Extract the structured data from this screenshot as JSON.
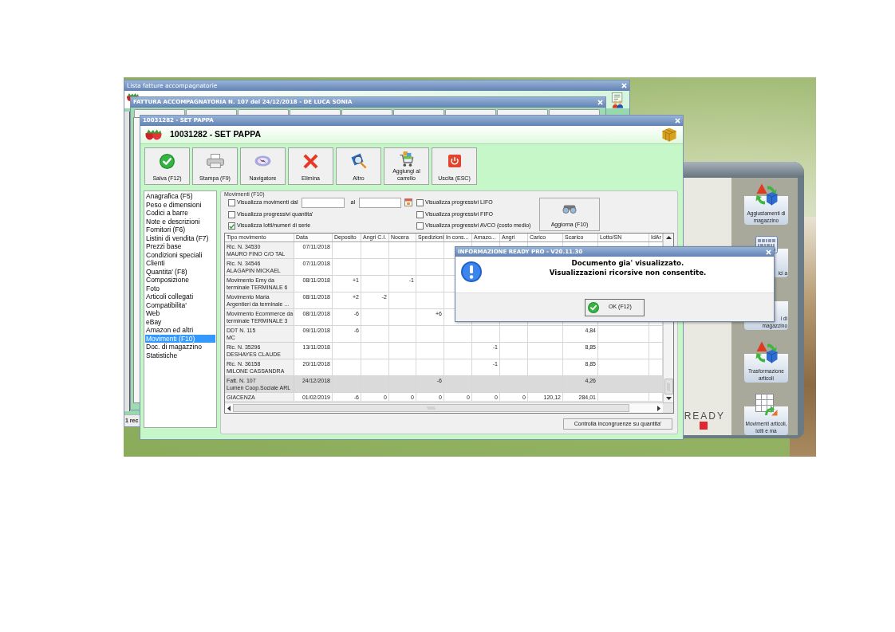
{
  "list_window": {
    "title": "Lista fatture accompagnatorie",
    "status": "1 rec"
  },
  "invoice_window": {
    "title": "FATTURA ACCOMPAGNATORIA N. 107 del 24/12/2018 - DE LUCA SONIA"
  },
  "side_panel": {
    "buttons": [
      {
        "lines": [
          "Aggiustamenti di",
          "magazzino"
        ],
        "kind": "adjust",
        "covered": false
      },
      {
        "lines": [
          "ici a"
        ],
        "kind": "barcode",
        "covered": true
      },
      {
        "lines": [
          "i di",
          "magazzino"
        ],
        "kind": "hidden",
        "covered": true
      },
      {
        "lines": [
          "Trasformazione",
          "articoli"
        ],
        "kind": "transform",
        "covered": false
      },
      {
        "lines": [
          "Movimenti articoli,",
          "lotti e ma"
        ],
        "kind": "movements",
        "covered": false
      }
    ],
    "logo": "READY"
  },
  "article_window": {
    "title": "10031282 - SET PAPPA",
    "heading": "10031282 - SET PAPPA",
    "toolbar": [
      {
        "label": "Salva (F12)",
        "kind": "save"
      },
      {
        "label": "Stampa (F9)",
        "kind": "print"
      },
      {
        "label": "Navigatore",
        "kind": "navigator"
      },
      {
        "label": "Elimina",
        "kind": "delete"
      },
      {
        "label": "Altro",
        "kind": "other"
      },
      {
        "label": "Aggiungi al carrello",
        "kind": "cart"
      },
      {
        "label": "Uscita (ESC)",
        "kind": "exit"
      }
    ],
    "sidebar": {
      "items": [
        {
          "label": "Anagrafica (F5)",
          "selected": false
        },
        {
          "label": "Peso e dimensioni",
          "selected": false
        },
        {
          "label": "Codici a barre",
          "selected": false
        },
        {
          "label": "Note e descrizioni",
          "selected": false
        },
        {
          "label": "Fornitori (F6)",
          "selected": false
        },
        {
          "label": "Listini di vendita (F7)",
          "selected": false
        },
        {
          "label": "Prezzi base",
          "selected": false
        },
        {
          "label": "Condizioni speciali",
          "selected": false
        },
        {
          "label": "Clienti",
          "selected": false
        },
        {
          "label": "Quantita' (F8)",
          "selected": false
        },
        {
          "label": "Composizione",
          "selected": false
        },
        {
          "label": "Foto",
          "selected": false
        },
        {
          "label": "Articoli collegati",
          "selected": false
        },
        {
          "label": "Compatibilita'",
          "selected": false
        },
        {
          "label": "Web",
          "selected": false
        },
        {
          "label": "eBay",
          "selected": false
        },
        {
          "label": "Amazon ed altri",
          "selected": false
        },
        {
          "label": "Movimenti (F10)",
          "selected": true
        },
        {
          "label": "Doc. di magazzino",
          "selected": false
        },
        {
          "label": "Statistiche",
          "selected": false
        }
      ]
    },
    "movements": {
      "title": "Movimenti (F10)",
      "date_filter": {
        "label": "Visualizza movimenti dal",
        "checked": false,
        "to_label": "al"
      },
      "options": [
        {
          "label": "Visualizza progressivi quantita'",
          "checked": false
        },
        {
          "label": "Visualizza lotti/numeri di serie",
          "checked": true
        }
      ],
      "cost_options": [
        {
          "label": "Visualizza progressivi LIFO",
          "checked": false
        },
        {
          "label": "Visualizza progressivi FIFO",
          "checked": false
        },
        {
          "label": "Visualizza progressivi AVCO (costo medio)",
          "checked": false
        }
      ],
      "refresh_button": "Aggiorna (F10)",
      "table": {
        "columns": [
          "Tipo movimento",
          "Data",
          "Deposito",
          "Angri C.I.",
          "Nocera",
          "Spedizioni",
          "In cons...",
          "Amazo...",
          "Angri",
          "Carico",
          "Scarico",
          "Lotto/SN",
          "IdAr"
        ],
        "rows": [
          {
            "kind": "movement",
            "cells": [
              "Ric. N. 34530\nMAURO FINO C/O TAL",
              "07/11/2018",
              "",
              "",
              "",
              "",
              "",
              "",
              "",
              "",
              "",
              "",
              ""
            ],
            "selected": false
          },
          {
            "kind": "movement",
            "cells": [
              "Ric. N. 34546\nALAGAPIN MICKAEL",
              "07/11/2018",
              "",
              "",
              "",
              "",
              "",
              "",
              "",
              "",
              "",
              "",
              ""
            ],
            "selected": false
          },
          {
            "kind": "movement",
            "cells": [
              "Movimento Emy da\nterminale TERMINALE 6",
              "08/11/2018",
              "+1",
              "",
              "-1",
              "",
              "",
              "",
              "",
              "",
              "",
              "",
              ""
            ],
            "selected": false
          },
          {
            "kind": "movement",
            "cells": [
              "Movimento Maria\nArgentieri da terminale ...",
              "08/11/2018",
              "+2",
              "-2",
              "",
              "",
              "",
              "",
              "",
              "",
              "",
              "",
              ""
            ],
            "selected": false
          },
          {
            "kind": "movement",
            "cells": [
              "Movimento Ecommerce da\nterminale TERMINALE 3",
              "08/11/2018",
              "-6",
              "",
              "",
              "+6",
              "",
              "",
              "",
              "",
              "",
              "",
              ""
            ],
            "selected": false
          },
          {
            "kind": "movement",
            "cells": [
              "DDT N. 115\nMC",
              "09/11/2018",
              "-6",
              "",
              "",
              "",
              "",
              "",
              "",
              "",
              "4,84",
              "",
              ""
            ],
            "selected": false
          },
          {
            "kind": "movement",
            "cells": [
              "Ric. N. 35296\nDESHAYES CLAUDE",
              "13/11/2018",
              "",
              "",
              "",
              "",
              "",
              "-1",
              "",
              "",
              "8,85",
              "",
              ""
            ],
            "selected": false
          },
          {
            "kind": "movement",
            "cells": [
              "Ric. N. 36158\nMILONE CASSANDRA",
              "20/11/2018",
              "",
              "",
              "",
              "",
              "",
              "-1",
              "",
              "",
              "8,85",
              "",
              ""
            ],
            "selected": false
          },
          {
            "kind": "movement",
            "cells": [
              "Fatt. N. 107\nLumen Coop.Sociale ARL",
              "24/12/2018",
              "",
              "",
              "",
              "-6",
              "",
              "",
              "",
              "",
              "4,26",
              "",
              ""
            ],
            "selected": true
          },
          {
            "kind": "total",
            "cells": [
              "GIACENZA",
              "01/02/2019",
              "-6",
              "0",
              "0",
              "0",
              "0",
              "0",
              "0",
              "120,12",
              "284,01",
              "",
              ""
            ],
            "selected": false
          }
        ]
      },
      "check_button": "Controlla incongruenze su quantita'"
    }
  },
  "dialog": {
    "title": "INFORMAZIONE READY PRO - V20.11.30",
    "message": [
      "Documento gia' visualizzato.",
      "Visualizzazioni ricorsive non consentite."
    ],
    "button": "OK (F12)"
  }
}
